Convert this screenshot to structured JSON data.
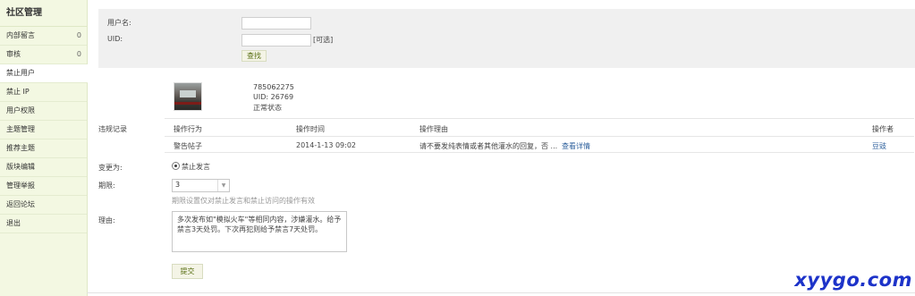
{
  "sidebar": {
    "title": "社区管理",
    "items": [
      {
        "label": "内部留言",
        "count": "0"
      },
      {
        "label": "审核",
        "count": "0"
      },
      {
        "label": "禁止用户",
        "count": ""
      },
      {
        "label": "禁止 IP",
        "count": ""
      },
      {
        "label": "用户权限",
        "count": ""
      },
      {
        "label": "主题管理",
        "count": ""
      },
      {
        "label": "推荐主题",
        "count": ""
      },
      {
        "label": "版块编辑",
        "count": ""
      },
      {
        "label": "管理举报",
        "count": ""
      },
      {
        "label": "返回论坛",
        "count": ""
      },
      {
        "label": "退出",
        "count": ""
      }
    ]
  },
  "search": {
    "username_label": "用户名:",
    "username_value": "",
    "uid_label": "UID:",
    "uid_value": "",
    "optional_hint": "[可选]",
    "search_button": "查找"
  },
  "user": {
    "name": "785062275",
    "uid": "UID: 26769",
    "status": "正常状态"
  },
  "records": {
    "section_label": "违规记录",
    "headers": [
      "操作行为",
      "操作时间",
      "操作理由",
      "操作者"
    ],
    "rows": [
      {
        "action": "警告帖子",
        "time": "2014-1-13 09:02",
        "reason": "请不要发纯表情或者其他灌水的回复，否 ...",
        "detail_link": "查看详情",
        "operator": "豆豉"
      }
    ]
  },
  "change": {
    "label": "变更为:",
    "option": "禁止发言"
  },
  "period": {
    "label": "期限:",
    "value": "3",
    "hint": "期限设置仅对禁止发言和禁止访问的操作有效"
  },
  "reason": {
    "label": "理由:",
    "text": "多次发布如\"模拟火车\"等相同内容，涉嫌灌水。给予禁言3天处罚。下次再犯则给予禁言7天处罚。"
  },
  "submit_button": "提交",
  "watermark": "xyygo.com"
}
